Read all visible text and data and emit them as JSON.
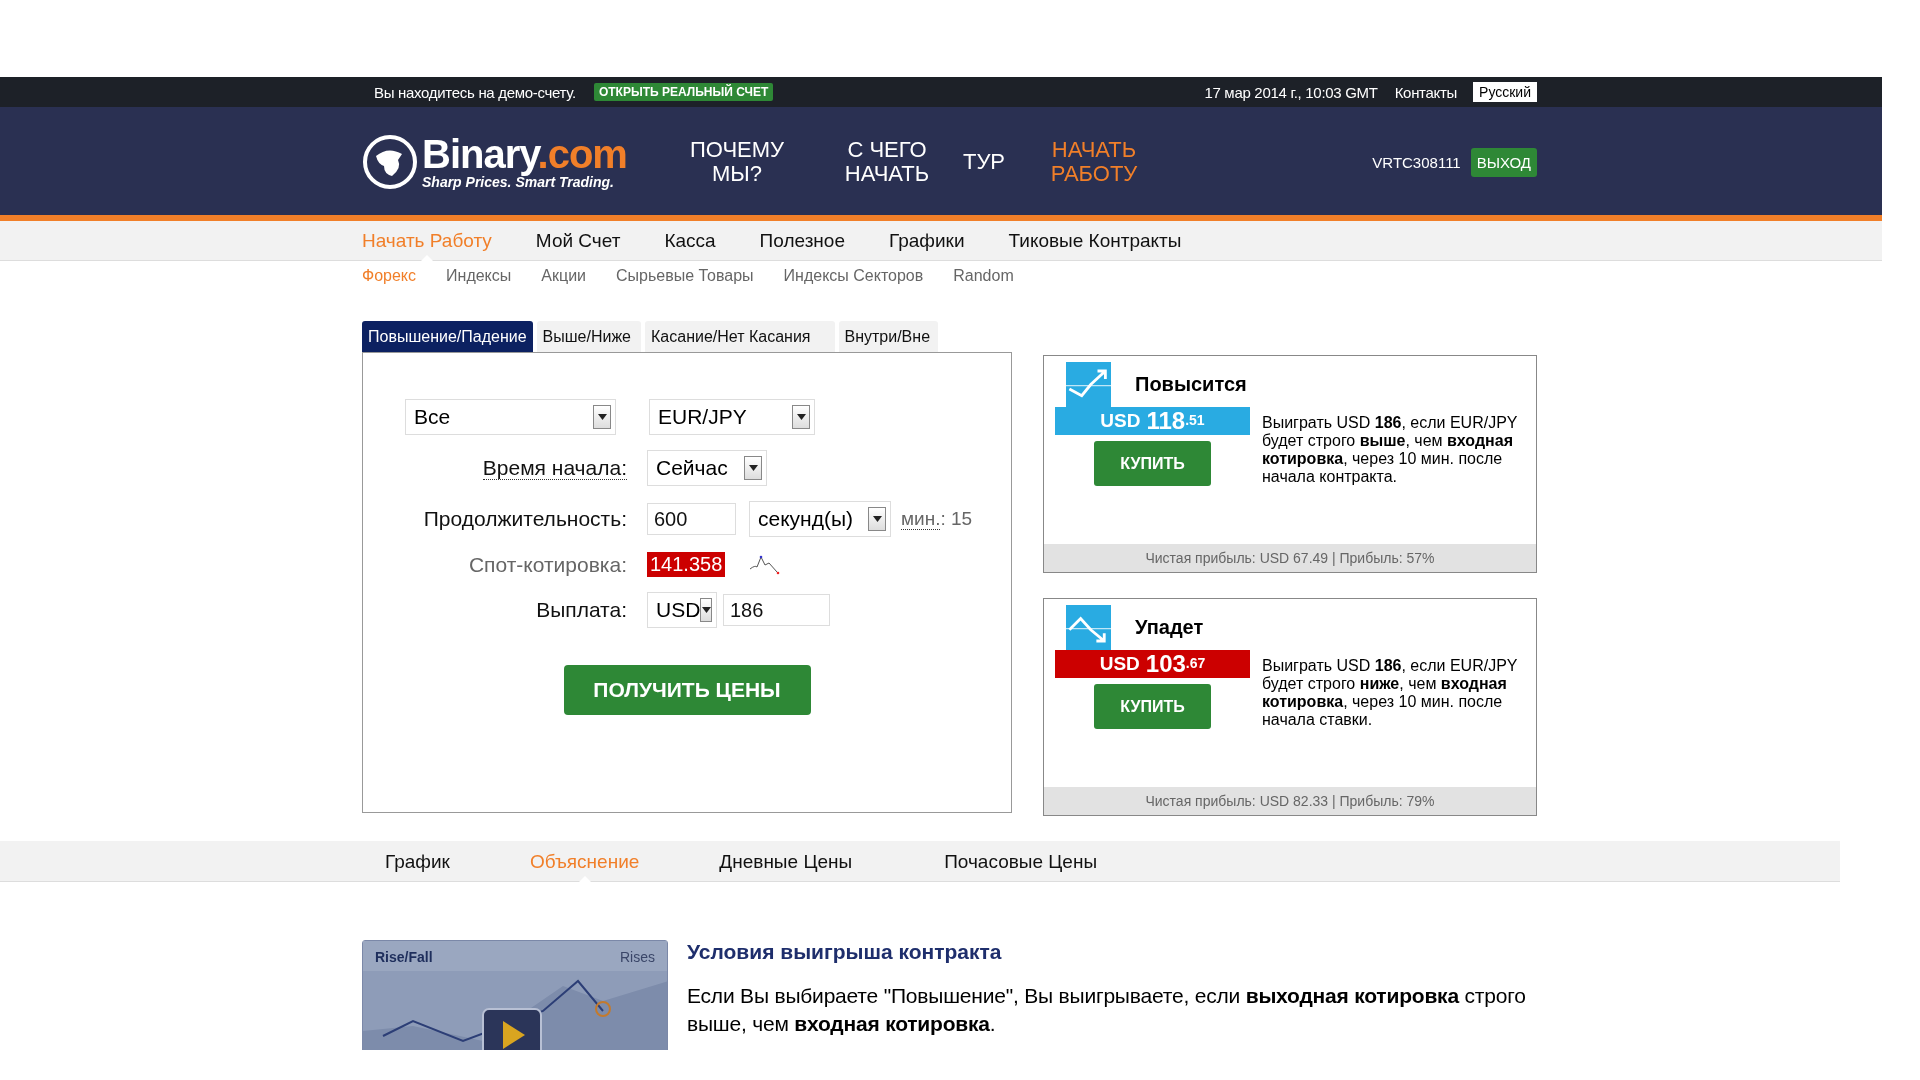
{
  "top_bar": {
    "demo_notice": "Вы находитесь на демо-счету.",
    "open_account": "ОТКРЫТЬ РЕАЛЬНЫЙ СЧЕТ",
    "datetime": "17 мар 2014 г., 10:03 GMT",
    "contacts": "Контакты",
    "language": "Русский"
  },
  "header": {
    "logo": {
      "name": "Binary",
      "suffix": ".com",
      "tagline": "Sharp Prices. Smart Trading."
    },
    "nav": [
      {
        "label": "ПОЧЕМУ МЫ?",
        "selected": false
      },
      {
        "label": "С ЧЕГО НАЧАТЬ",
        "selected": false
      },
      {
        "label": "ТУР",
        "selected": false
      },
      {
        "label": "НАЧАТЬ РАБОТУ",
        "selected": true
      }
    ],
    "account_id": "VRTC308111",
    "logout": "ВЫХОД"
  },
  "main_menu": [
    {
      "label": "Начать Работу",
      "selected": true
    },
    {
      "label": "Мой Счет",
      "selected": false
    },
    {
      "label": "Касса",
      "selected": false
    },
    {
      "label": "Полезное",
      "selected": false
    },
    {
      "label": "Графики",
      "selected": false
    },
    {
      "label": "Тиковые Контракты",
      "selected": false
    }
  ],
  "sub_menu": [
    {
      "label": "Форекс",
      "selected": true
    },
    {
      "label": "Индексы",
      "selected": false
    },
    {
      "label": "Акции",
      "selected": false
    },
    {
      "label": "Сырьевые Товары",
      "selected": false
    },
    {
      "label": "Индексы Секторов",
      "selected": false
    },
    {
      "label": "Random",
      "selected": false
    }
  ],
  "contract_tabs": [
    {
      "label": "Повышение/Падение",
      "selected": true
    },
    {
      "label": "Выше/Ниже",
      "selected": false
    },
    {
      "label": "Касание/Нет Касания",
      "selected": false
    },
    {
      "label": "Внутри/Вне",
      "selected": false
    }
  ],
  "form": {
    "market": "Все",
    "underlying": "EUR/JPY",
    "start_time": {
      "label": "Время начала:",
      "value": "Сейчас"
    },
    "duration": {
      "label": "Продолжительность:",
      "amount": "600",
      "unit": "секунд(ы)",
      "min_label": "мин.",
      "min_value": ": 15"
    },
    "spot": {
      "label": "Спот-котировка:",
      "value": "141.358"
    },
    "payout": {
      "label": "Выплата:",
      "currency": "USD",
      "amount": "186"
    },
    "submit": "ПОЛУЧИТЬ ЦЕНЫ"
  },
  "offers": [
    {
      "kind": "rise",
      "title": "Повысится",
      "currency": "USD",
      "amount": "118",
      "cents": ".51",
      "color": "#29abe2",
      "buy": "КУПИТЬ",
      "description": "Выиграть USD **186**, если EUR/JPY будет строго **выше**, чем **входная котировка**, через 10 мин. после начала контракта.",
      "footer": "Чистая прибыль: USD 67.49 | Прибыль: 57%"
    },
    {
      "kind": "fall",
      "title": "Упадет",
      "currency": "USD",
      "amount": "103",
      "cents": ".67",
      "color": "#cc0000",
      "buy": "КУПИТЬ",
      "description": "Выиграть USD **186**, если EUR/JPY будет строго **ниже**, чем **входная котировка**, через 10 мин. после начала ставки.",
      "footer": "Чистая прибыль: USD 82.33 | Прибыль: 79%"
    }
  ],
  "info_tabs": [
    {
      "label": "График",
      "selected": false
    },
    {
      "label": "Объяснение",
      "selected": true
    },
    {
      "label": "Дневные Цены",
      "selected": false
    },
    {
      "label": "Почасовые Цены",
      "selected": false
    }
  ],
  "explanation": {
    "video": {
      "title": "Rise/Fall",
      "label": "Rises"
    },
    "heading": "Условия выигрыша контракта",
    "text": "Если Вы выбираете \"Повышение\", Вы выигрываете, если **выходная котировка** строго выше, чем **входная котировка**."
  }
}
